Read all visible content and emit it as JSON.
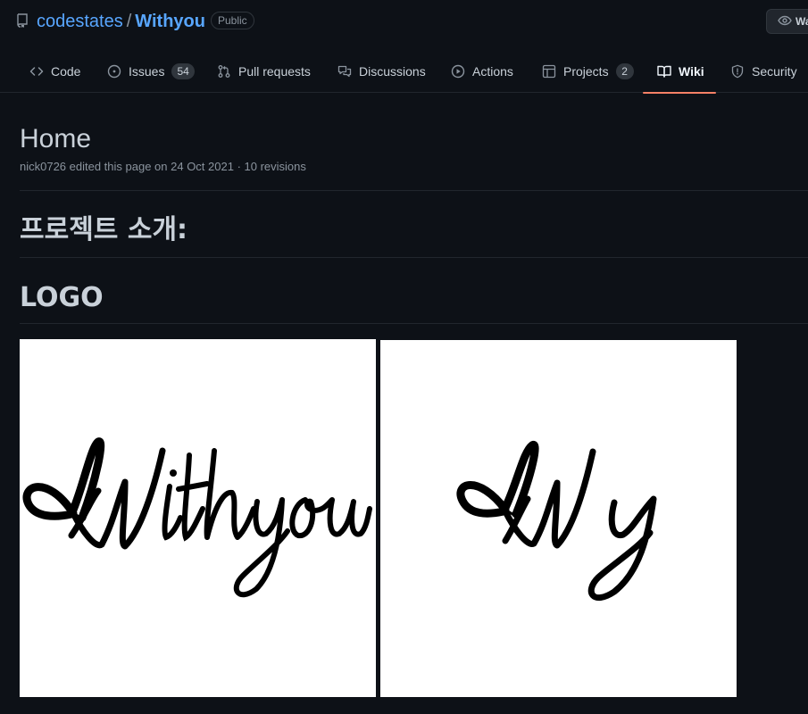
{
  "repo": {
    "owner": "codestates",
    "separator": "/",
    "name": "Withyou",
    "visibility": "Public",
    "watch_label": "Watch"
  },
  "tabs": [
    {
      "label": "Code",
      "icon": "code-icon"
    },
    {
      "label": "Issues",
      "count": "54",
      "icon": "issue-icon"
    },
    {
      "label": "Pull requests",
      "icon": "pull-request-icon"
    },
    {
      "label": "Discussions",
      "icon": "discussions-icon"
    },
    {
      "label": "Actions",
      "icon": "play-icon"
    },
    {
      "label": "Projects",
      "count": "2",
      "icon": "table-icon"
    },
    {
      "label": "Wiki",
      "icon": "book-icon",
      "active": true
    },
    {
      "label": "Security",
      "icon": "shield-icon"
    }
  ],
  "wiki": {
    "title": "Home",
    "meta": "nick0726 edited this page on 24 Oct 2021 · 10 revisions",
    "heading_intro": "프로젝트 소개:",
    "heading_logo": "LOGO",
    "images": [
      {
        "logo_text": "Withyou"
      },
      {
        "logo_text": "Wy"
      }
    ]
  },
  "colors": {
    "background": "#0d1117",
    "link": "#58a6ff",
    "active_tab_underline": "#f78166"
  }
}
